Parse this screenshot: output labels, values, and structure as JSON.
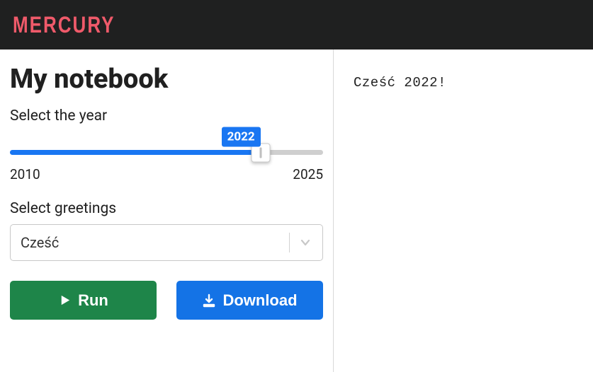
{
  "brand": "mercury",
  "sidebar": {
    "title": "My notebook",
    "year_label": "Select the year",
    "year_value": "2022",
    "year_min": "2010",
    "year_max": "2025",
    "greetings_label": "Select greetings",
    "greetings_value": "Cześć",
    "run_label": "Run",
    "download_label": "Download"
  },
  "output": {
    "text": "Cześć 2022!"
  },
  "slider": {
    "percent": 80
  },
  "colors": {
    "accent": "#1976f2",
    "success": "#1e8549",
    "brand": "#ef5a6a"
  }
}
